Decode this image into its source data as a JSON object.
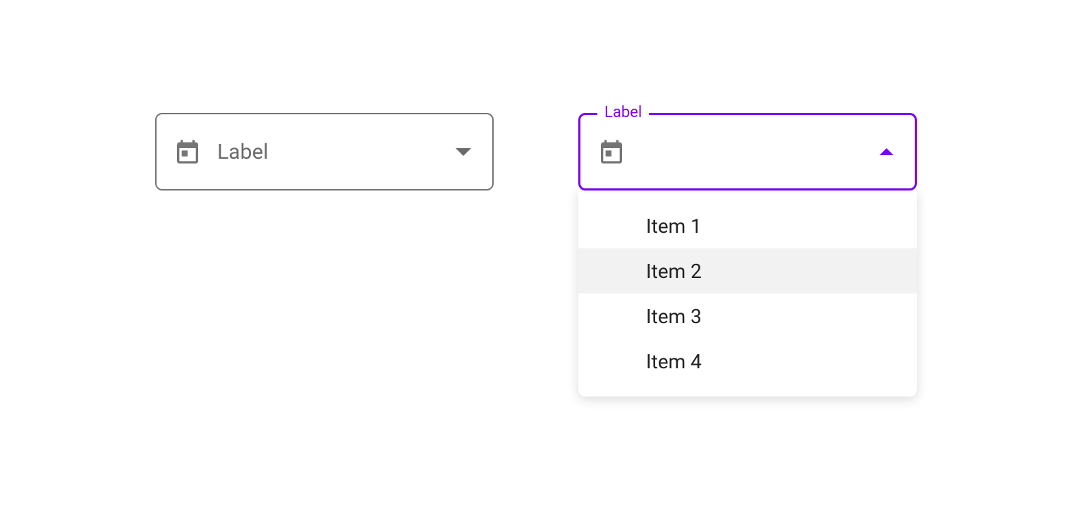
{
  "colors": {
    "accent": "#7c00f3",
    "border": "#757575",
    "text_muted": "#6b6b6b",
    "hover_bg": "#f2f2f2"
  },
  "select_closed": {
    "placeholder": "Label",
    "icon": "calendar-icon"
  },
  "select_open": {
    "floating_label": "Label",
    "icon": "calendar-icon",
    "items": [
      {
        "label": "Item 1",
        "hovered": false
      },
      {
        "label": "Item 2",
        "hovered": true
      },
      {
        "label": "Item 3",
        "hovered": false
      },
      {
        "label": "Item 4",
        "hovered": false
      }
    ]
  }
}
